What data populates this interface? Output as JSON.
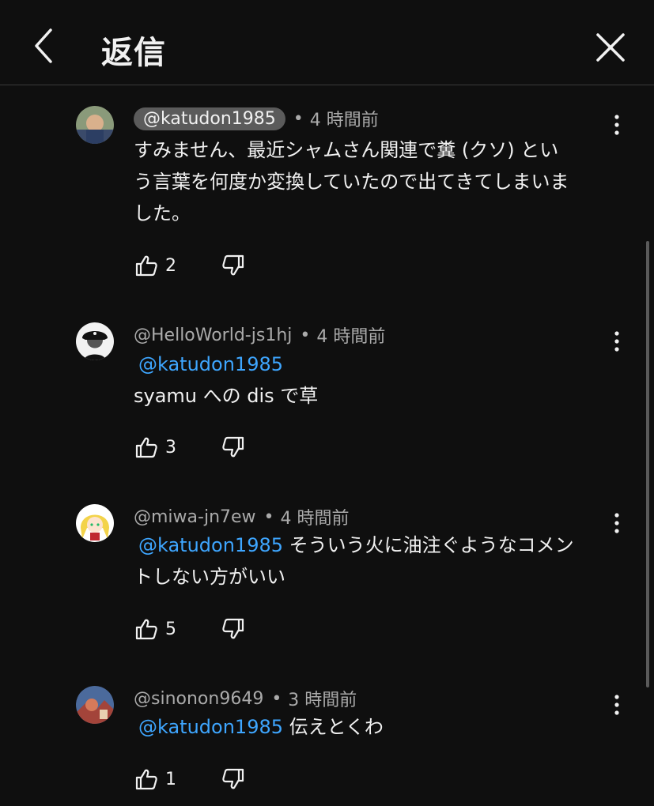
{
  "header": {
    "title": "返信",
    "back_icon": "chevron-left-icon",
    "close_icon": "close-icon"
  },
  "comments": [
    {
      "handle": "@katudon1985",
      "time": "4 時間前",
      "mention": "",
      "text_line1": "すみません、最近シャムさん関連で糞 (クソ) とい",
      "text_line2": "う言葉を何度か変換していたので出てきてしまいま",
      "text_line3": "した。",
      "likes": "2"
    },
    {
      "handle": "@HelloWorld-js1hj",
      "time": "4 時間前",
      "mention": "@katudon1985",
      "text_line1": "syamu への dis で草",
      "likes": "3"
    },
    {
      "handle": "@miwa-jn7ew",
      "time": "4 時間前",
      "mention": "@katudon1985",
      "text_inline": "そういう火に油注ぐようなコメン",
      "text_line2": "トしない方がいい",
      "likes": "5"
    },
    {
      "handle": "@sinonon9649",
      "time": "3 時間前",
      "mention": "@katudon1985",
      "text_inline": "伝えとくわ",
      "likes": "1"
    }
  ],
  "colors": {
    "background": "#0f0f0f",
    "text": "#f1f1f1",
    "secondary": "#aaaaaa",
    "mention": "#3ea6ff",
    "pill": "#5b5b5b"
  }
}
